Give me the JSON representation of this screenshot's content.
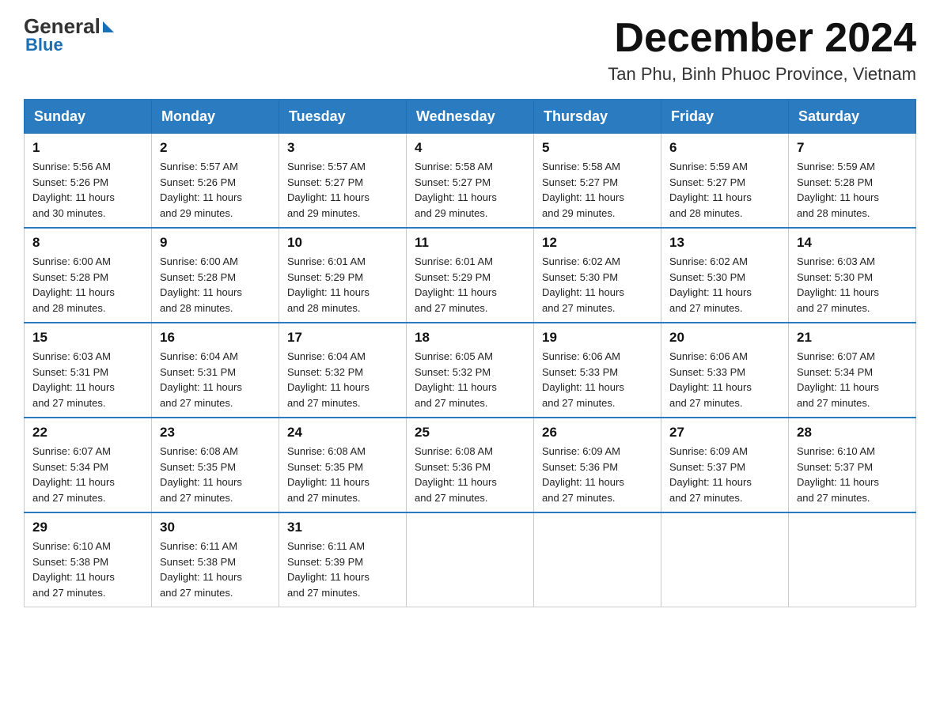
{
  "header": {
    "logo_general": "General",
    "logo_blue": "Blue",
    "month_title": "December 2024",
    "location": "Tan Phu, Binh Phuoc Province, Vietnam"
  },
  "weekdays": [
    "Sunday",
    "Monday",
    "Tuesday",
    "Wednesday",
    "Thursday",
    "Friday",
    "Saturday"
  ],
  "weeks": [
    [
      {
        "day": "1",
        "sunrise": "5:56 AM",
        "sunset": "5:26 PM",
        "daylight": "11 hours and 30 minutes."
      },
      {
        "day": "2",
        "sunrise": "5:57 AM",
        "sunset": "5:26 PM",
        "daylight": "11 hours and 29 minutes."
      },
      {
        "day": "3",
        "sunrise": "5:57 AM",
        "sunset": "5:27 PM",
        "daylight": "11 hours and 29 minutes."
      },
      {
        "day": "4",
        "sunrise": "5:58 AM",
        "sunset": "5:27 PM",
        "daylight": "11 hours and 29 minutes."
      },
      {
        "day": "5",
        "sunrise": "5:58 AM",
        "sunset": "5:27 PM",
        "daylight": "11 hours and 29 minutes."
      },
      {
        "day": "6",
        "sunrise": "5:59 AM",
        "sunset": "5:27 PM",
        "daylight": "11 hours and 28 minutes."
      },
      {
        "day": "7",
        "sunrise": "5:59 AM",
        "sunset": "5:28 PM",
        "daylight": "11 hours and 28 minutes."
      }
    ],
    [
      {
        "day": "8",
        "sunrise": "6:00 AM",
        "sunset": "5:28 PM",
        "daylight": "11 hours and 28 minutes."
      },
      {
        "day": "9",
        "sunrise": "6:00 AM",
        "sunset": "5:28 PM",
        "daylight": "11 hours and 28 minutes."
      },
      {
        "day": "10",
        "sunrise": "6:01 AM",
        "sunset": "5:29 PM",
        "daylight": "11 hours and 28 minutes."
      },
      {
        "day": "11",
        "sunrise": "6:01 AM",
        "sunset": "5:29 PM",
        "daylight": "11 hours and 27 minutes."
      },
      {
        "day": "12",
        "sunrise": "6:02 AM",
        "sunset": "5:30 PM",
        "daylight": "11 hours and 27 minutes."
      },
      {
        "day": "13",
        "sunrise": "6:02 AM",
        "sunset": "5:30 PM",
        "daylight": "11 hours and 27 minutes."
      },
      {
        "day": "14",
        "sunrise": "6:03 AM",
        "sunset": "5:30 PM",
        "daylight": "11 hours and 27 minutes."
      }
    ],
    [
      {
        "day": "15",
        "sunrise": "6:03 AM",
        "sunset": "5:31 PM",
        "daylight": "11 hours and 27 minutes."
      },
      {
        "day": "16",
        "sunrise": "6:04 AM",
        "sunset": "5:31 PM",
        "daylight": "11 hours and 27 minutes."
      },
      {
        "day": "17",
        "sunrise": "6:04 AM",
        "sunset": "5:32 PM",
        "daylight": "11 hours and 27 minutes."
      },
      {
        "day": "18",
        "sunrise": "6:05 AM",
        "sunset": "5:32 PM",
        "daylight": "11 hours and 27 minutes."
      },
      {
        "day": "19",
        "sunrise": "6:06 AM",
        "sunset": "5:33 PM",
        "daylight": "11 hours and 27 minutes."
      },
      {
        "day": "20",
        "sunrise": "6:06 AM",
        "sunset": "5:33 PM",
        "daylight": "11 hours and 27 minutes."
      },
      {
        "day": "21",
        "sunrise": "6:07 AM",
        "sunset": "5:34 PM",
        "daylight": "11 hours and 27 minutes."
      }
    ],
    [
      {
        "day": "22",
        "sunrise": "6:07 AM",
        "sunset": "5:34 PM",
        "daylight": "11 hours and 27 minutes."
      },
      {
        "day": "23",
        "sunrise": "6:08 AM",
        "sunset": "5:35 PM",
        "daylight": "11 hours and 27 minutes."
      },
      {
        "day": "24",
        "sunrise": "6:08 AM",
        "sunset": "5:35 PM",
        "daylight": "11 hours and 27 minutes."
      },
      {
        "day": "25",
        "sunrise": "6:08 AM",
        "sunset": "5:36 PM",
        "daylight": "11 hours and 27 minutes."
      },
      {
        "day": "26",
        "sunrise": "6:09 AM",
        "sunset": "5:36 PM",
        "daylight": "11 hours and 27 minutes."
      },
      {
        "day": "27",
        "sunrise": "6:09 AM",
        "sunset": "5:37 PM",
        "daylight": "11 hours and 27 minutes."
      },
      {
        "day": "28",
        "sunrise": "6:10 AM",
        "sunset": "5:37 PM",
        "daylight": "11 hours and 27 minutes."
      }
    ],
    [
      {
        "day": "29",
        "sunrise": "6:10 AM",
        "sunset": "5:38 PM",
        "daylight": "11 hours and 27 minutes."
      },
      {
        "day": "30",
        "sunrise": "6:11 AM",
        "sunset": "5:38 PM",
        "daylight": "11 hours and 27 minutes."
      },
      {
        "day": "31",
        "sunrise": "6:11 AM",
        "sunset": "5:39 PM",
        "daylight": "11 hours and 27 minutes."
      },
      null,
      null,
      null,
      null
    ]
  ],
  "labels": {
    "sunrise": "Sunrise:",
    "sunset": "Sunset:",
    "daylight": "Daylight:"
  }
}
